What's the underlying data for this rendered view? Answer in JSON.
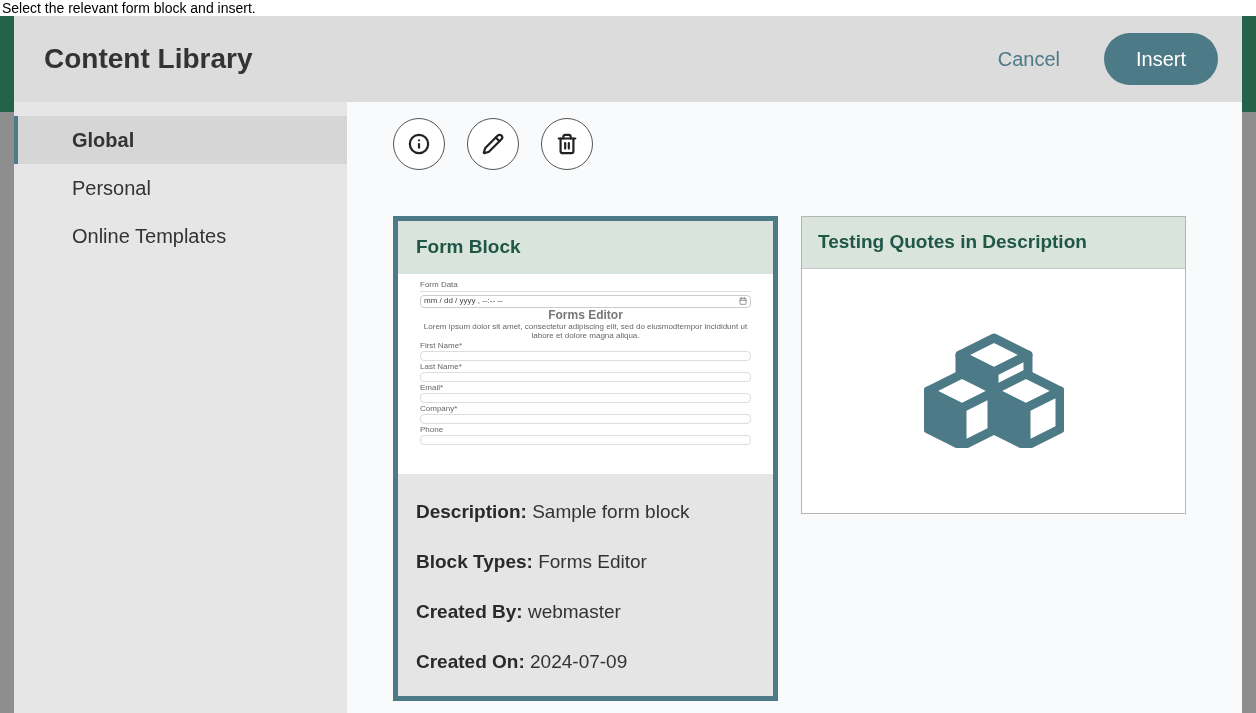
{
  "caption": "Select the relevant form block and insert.",
  "dialog": {
    "title": "Content Library",
    "actions": [
      {
        "kind": "link",
        "label": "Cancel"
      },
      {
        "kind": "primary",
        "label": "Insert"
      }
    ]
  },
  "sidebar": {
    "items": [
      {
        "label": "Global",
        "selected": true
      },
      {
        "label": "Personal",
        "selected": false
      },
      {
        "label": "Online Templates",
        "selected": false
      }
    ]
  },
  "toolbar": [
    {
      "kind": "info"
    },
    {
      "kind": "edit"
    },
    {
      "kind": "delete"
    }
  ],
  "cards": [
    {
      "title": "Form Block",
      "selected": true,
      "preview": {
        "kind": "form",
        "section_label": "Form Data",
        "date_placeholder": "mm / dd / yyyy , --:-- --",
        "heading": "Forms Editor",
        "intro": "Lorem ipsum dolor sit amet, consectetur adipiscing elit, sed do eiusmodtempor incididunt ut labore et dolore magna aliqua.",
        "fields": [
          "First Name*",
          "Last Name*",
          "Email*",
          "Company*",
          "Phone"
        ]
      },
      "details": [
        {
          "label": "Description:",
          "value": "Sample form block"
        },
        {
          "label": "Block Types:",
          "value": "Forms Editor"
        },
        {
          "label": "Created By:",
          "value": "webmaster"
        },
        {
          "label": "Created On:",
          "value": "2024-07-09"
        }
      ]
    },
    {
      "title": "Testing Quotes in Description",
      "selected": false,
      "preview": {
        "kind": "blocks"
      }
    }
  ]
}
